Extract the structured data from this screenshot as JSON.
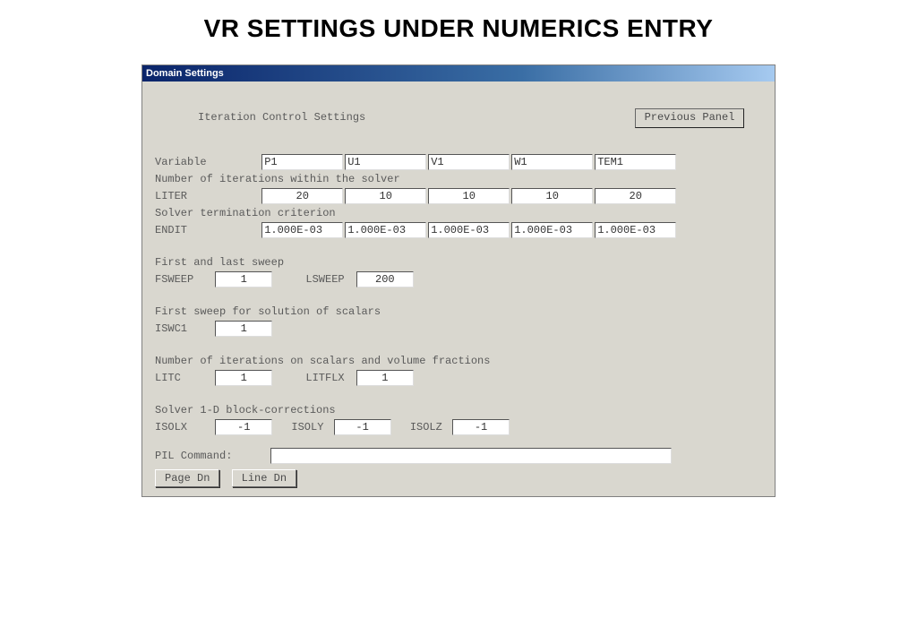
{
  "page_title": "VR SETTINGS UNDER NUMERICS ENTRY",
  "window_title": "Domain Settings",
  "section_title": "Iteration Control Settings",
  "prev_panel_label": "Previous Panel",
  "labels": {
    "variable": "Variable",
    "num_iter": "Number of iterations within the solver",
    "liter": "LITER",
    "term_crit": "Solver termination criterion",
    "endit": "ENDIT",
    "first_last_sweep": "First and last sweep",
    "fsweep": "FSWEEP",
    "lsweep": "LSWEEP",
    "first_sweep_scalars": "First sweep for solution of scalars",
    "iswc1": "ISWC1",
    "num_iter_scalars": "Number of iterations on scalars and volume fractions",
    "litc": "LITC",
    "litflx": "LITFLX",
    "block_corr": "Solver 1-D block-corrections",
    "isolx": "ISOLX",
    "isoly": "ISOLY",
    "isolz": "ISOLZ",
    "pil_command": "PIL Command:"
  },
  "variable_row": [
    "P1",
    "U1",
    "V1",
    "W1",
    "TEM1"
  ],
  "liter_row": [
    "20",
    "10",
    "10",
    "10",
    "20"
  ],
  "endit_row": [
    "1.000E-03",
    "1.000E-03",
    "1.000E-03",
    "1.000E-03",
    "1.000E-03"
  ],
  "fsweep": "1",
  "lsweep": "200",
  "iswc1": "1",
  "litc": "1",
  "litflx": "1",
  "isolx": "-1",
  "isoly": "-1",
  "isolz": "-1",
  "pil_command_value": "",
  "buttons": {
    "page_dn": "Page Dn",
    "line_dn": "Line Dn"
  }
}
